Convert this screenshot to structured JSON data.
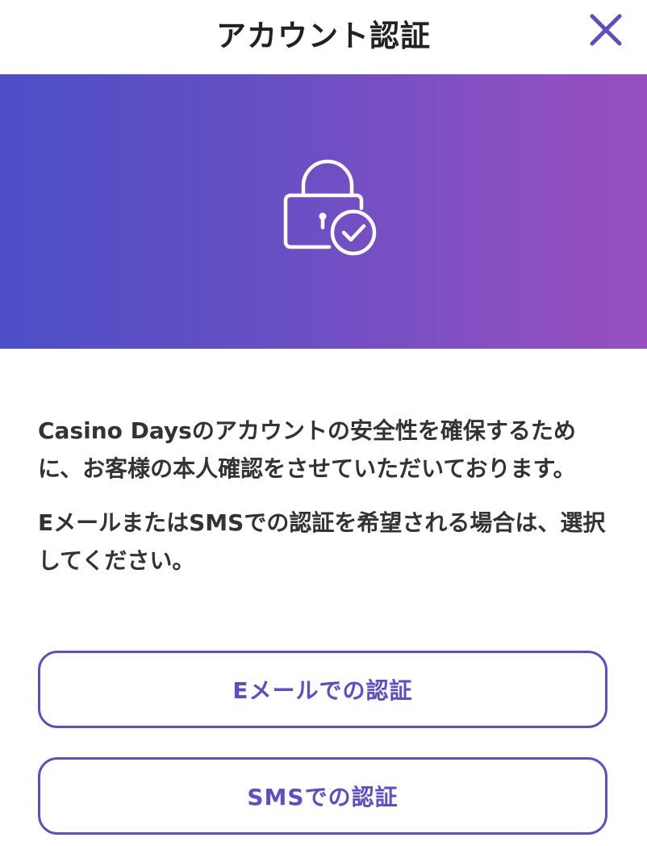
{
  "header": {
    "title": "アカウント認証",
    "close_icon": "close-icon"
  },
  "banner": {
    "icon": "lock-check-icon",
    "gradient_start": "#4d4fc6",
    "gradient_end": "#974fc0"
  },
  "body": {
    "paragraph1": "Casino Daysのアカウントの安全性を確保するために、お客様の本人確認をさせていただいております。",
    "paragraph2": "EメールまたはSMSでの認証を希望される場合は、選択してください。"
  },
  "buttons": {
    "email_label": "Eメールでの認証",
    "sms_label": "SMSでの認証"
  },
  "colors": {
    "accent": "#5a4fc8",
    "text": "#333333",
    "title": "#222222"
  }
}
